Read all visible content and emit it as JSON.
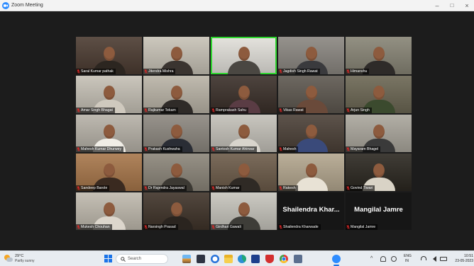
{
  "window": {
    "title": "Zoom Meeting",
    "app_icon": "zoom-logo-icon",
    "minimize": "–",
    "maximize": "□",
    "close": "×"
  },
  "colors": {
    "active_speaker_border": "#2fd52f",
    "muted_icon": "#e02828",
    "zoom_blue": "#2d8cff",
    "meeting_bg": "#1c1c1c",
    "taskbar_bg": "#e7ecf1"
  },
  "participants": [
    {
      "name": "Saral Kumar pathak",
      "muted": true,
      "video": true,
      "video_bg": "#4b3b31",
      "shirt": "#2c2620"
    },
    {
      "name": "Jitendra Mishra",
      "muted": true,
      "video": true,
      "video_bg": "#c7c2b6",
      "shirt": "#3a3430"
    },
    {
      "video": true,
      "active_speaker": true,
      "video_bg": "#e2e0da",
      "shirt": "#4a4742"
    },
    {
      "name": "Jagdish Singh Rawat",
      "muted": true,
      "video": true,
      "video_bg": "#8a8680",
      "shirt": "#3a3a3d"
    },
    {
      "name": "Himanshu",
      "muted": true,
      "video": true,
      "video_bg": "#878475",
      "shirt": "#2e2b29"
    },
    {
      "name": "Amar Singh Bhagat",
      "muted": true,
      "video": true,
      "video_bg": "#c5c0b5",
      "shirt": "#cfc9be"
    },
    {
      "name": "Rajkumar Tekam",
      "muted": true,
      "video": true,
      "video_bg": "#b9b3a6",
      "shirt": "#2f2b28"
    },
    {
      "name": "Ramprakash Sahu",
      "muted": true,
      "video": true,
      "video_bg": "#3a2f29",
      "shirt": "#5a3c44"
    },
    {
      "name": "Vikas Rawat",
      "muted": true,
      "video": true,
      "video_bg": "#5d574f",
      "shirt": "#6a4a3a"
    },
    {
      "name": "Arjun Singh",
      "muted": true,
      "video": true,
      "video_bg": "#6b6653",
      "shirt": "#3b4a2e"
    },
    {
      "name": "Mahesh Kumar Dhurwey",
      "muted": true,
      "video": true,
      "video_bg": "#b6b1a7",
      "shirt": "#f0ede6"
    },
    {
      "name": "Prakash Kushwaha",
      "muted": true,
      "video": true,
      "video_bg": "#8c877f",
      "shirt": "#2a2d35"
    },
    {
      "name": "Santosh Kumar Ahirwar",
      "muted": true,
      "video": true,
      "video_bg": "#c3c0b8",
      "shirt": "#d8d4cc"
    },
    {
      "name": "Mahesh",
      "muted": true,
      "video": true,
      "video_bg": "#4b4037",
      "shirt": "#3a4a7a"
    },
    {
      "name": "Mayaram Bhagel",
      "muted": true,
      "video": true,
      "video_bg": "#aaa69c",
      "shirt": "#3a3a3a"
    },
    {
      "name": "Sandeep Barole",
      "muted": true,
      "video": true,
      "video_bg": "#a7764a",
      "shirt": "#3a2a20"
    },
    {
      "name": "Dr Rajendra Jayaswal",
      "muted": true,
      "video": true,
      "video_bg": "#8b8579",
      "shirt": "#3c3933"
    },
    {
      "name": "Manish Kumar",
      "muted": true,
      "video": true,
      "video_bg": "#6c5b49",
      "shirt": "#2f2a25"
    },
    {
      "name": "Rakesh",
      "muted": true,
      "video": true,
      "video_bg": "#b3a68e",
      "shirt": "#e8e2d5"
    },
    {
      "name": "Govind Tiwari",
      "muted": true,
      "video": true,
      "video_bg": "#2b2720",
      "shirt": "#d9d3c6"
    },
    {
      "name": "Mukesh Chouhan",
      "muted": true,
      "video": true,
      "video_bg": "#bfb9ad",
      "shirt": "#dcd6cc"
    },
    {
      "name": "Narsingh Prasad",
      "muted": true,
      "video": true,
      "video_bg": "#3f3329",
      "shirt": "#2a241f"
    },
    {
      "name": "Girdhari Gawali",
      "muted": true,
      "video": true,
      "video_bg": "#c6c4bc",
      "shirt": "#3e3d38"
    },
    {
      "name": "Shailendra Kharwade",
      "display_name": "Shailendra Khar...",
      "muted": true,
      "video": false
    },
    {
      "name": "Mangilal Jamre",
      "display_name": "Mangilal Jamre",
      "muted": true,
      "video": false
    }
  ],
  "taskbar": {
    "weather": {
      "icon": "weather-partly-sunny-icon",
      "temp": "29°C",
      "condition": "Partly sunny"
    },
    "start_icon": "windows-start-icon",
    "search_placeholder": "Search",
    "apps": [
      "photos-icon",
      "task-view-icon",
      "search-app-icon",
      "file-explorer-icon",
      "edge-icon",
      "store-icon",
      "mcafee-icon",
      "chrome-icon",
      "app-icon",
      "zoom-icon"
    ],
    "tray": {
      "chevron": "^",
      "lang_top": "ENG",
      "lang_bottom": "IN",
      "time": "10:51",
      "date": "23-05-2023"
    }
  }
}
